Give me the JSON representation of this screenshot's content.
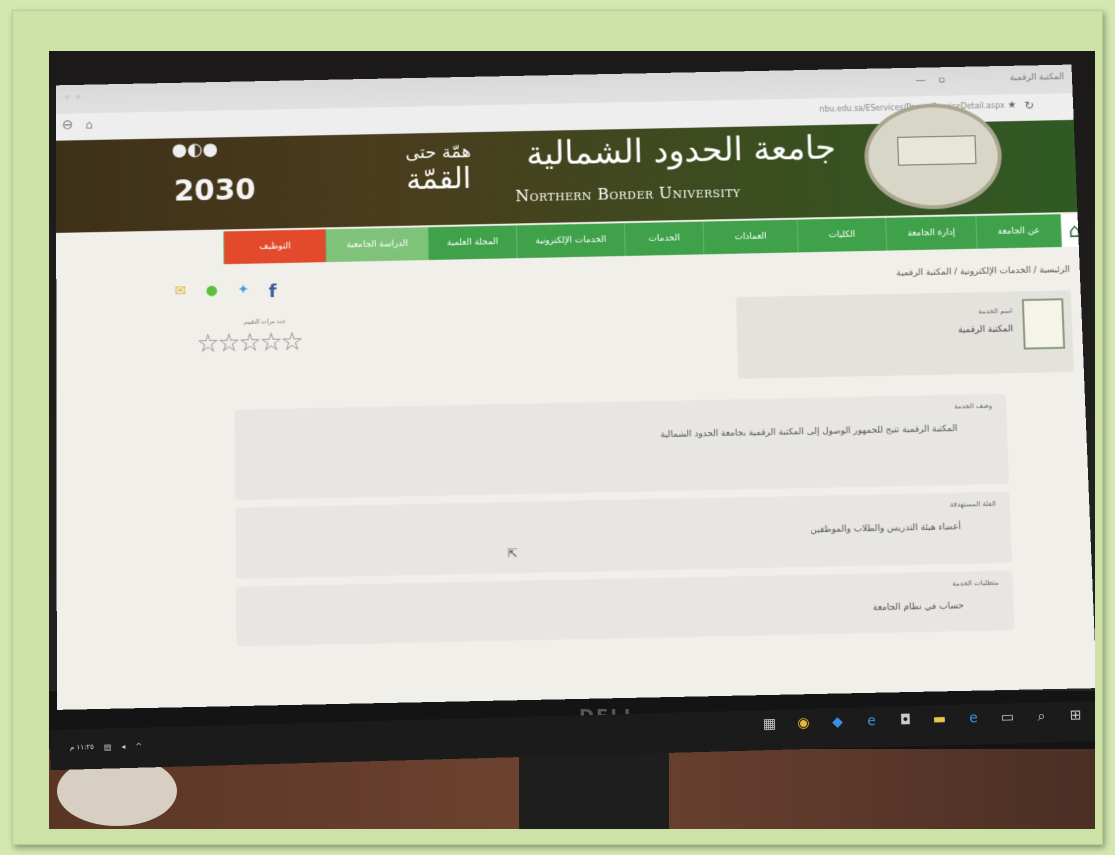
{
  "browser": {
    "tab_title": "المكتبة الرقمية",
    "url": "nbu.edu.sa/EServices/Pages/ServiceDetail.aspx"
  },
  "header": {
    "vision_text": "2030",
    "summit_text": "القمّة",
    "summit_top": "همّة حتى",
    "university_arabic": "جامعة الحدود الشمالية",
    "university_english": "Northern Border University"
  },
  "nav": {
    "items": [
      "عن الجامعة",
      "إدارة الجامعة",
      "الكليات",
      "العمادات",
      "الخدمات",
      "الخدمات الإلكترونية",
      "المجلة العلمية",
      "الدراسة الجامعية",
      "التوظيف"
    ]
  },
  "breadcrumb": "الرئيسية / الخدمات الإلكترونية / المكتبة الرقمية",
  "service": {
    "label": "اسم الخدمة",
    "name": "المكتبة الرقمية"
  },
  "rating": {
    "label": "عدد مرات التقييم",
    "stars": "☆☆☆☆☆",
    "value": 0
  },
  "panels": [
    {
      "label": "وصف الخدمة",
      "text": "المكتبة الرقمية تتيح للجمهور الوصول إلى المكتبة الرقمية بجامعة الحدود الشمالية"
    },
    {
      "label": "الفئة المستهدفة",
      "text": "أعضاء هيئة التدريس والطلاب والموظفين"
    },
    {
      "label": "متطلبات الخدمة",
      "text": "حساب في نظام الجامعة"
    }
  ],
  "monitor": {
    "brand": "DELL"
  },
  "taskbar": {
    "clock": "١١:٢٥ م"
  },
  "colors": {
    "nav_green": "#3fa14a",
    "nav_red": "#e34a2c",
    "banner_green": "#2f5a24",
    "frame_green": "#cde2a6"
  }
}
